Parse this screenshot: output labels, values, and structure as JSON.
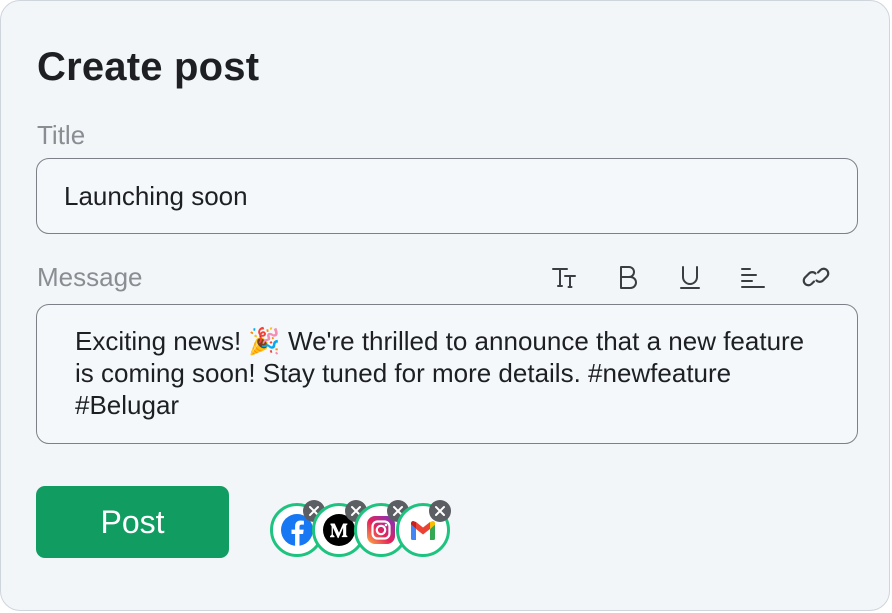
{
  "page_title": "Create post",
  "title_field": {
    "label": "Title",
    "value": "Launching soon"
  },
  "message_field": {
    "label": "Message",
    "value": "Exciting news! 🎉 We're thrilled to announce that a new feature is coming soon! Stay tuned for more details. #newfeature #Belugar"
  },
  "toolbar": {
    "tools": [
      "text-size-icon",
      "bold-icon",
      "underline-icon",
      "align-left-icon",
      "link-icon"
    ]
  },
  "post_button": {
    "label": "Post"
  },
  "channels": [
    {
      "name": "facebook",
      "icon": "facebook-icon",
      "remove_icon": "close-icon"
    },
    {
      "name": "medium",
      "icon": "medium-icon",
      "remove_icon": "close-icon"
    },
    {
      "name": "instagram",
      "icon": "instagram-icon",
      "remove_icon": "close-icon"
    },
    {
      "name": "gmail",
      "icon": "gmail-icon",
      "remove_icon": "close-icon"
    }
  ],
  "colors": {
    "primary": "#119d62",
    "channel_ring": "#1ec37f",
    "card_bg": "#f3f6f9",
    "remove_badge": "#5b5e63"
  }
}
